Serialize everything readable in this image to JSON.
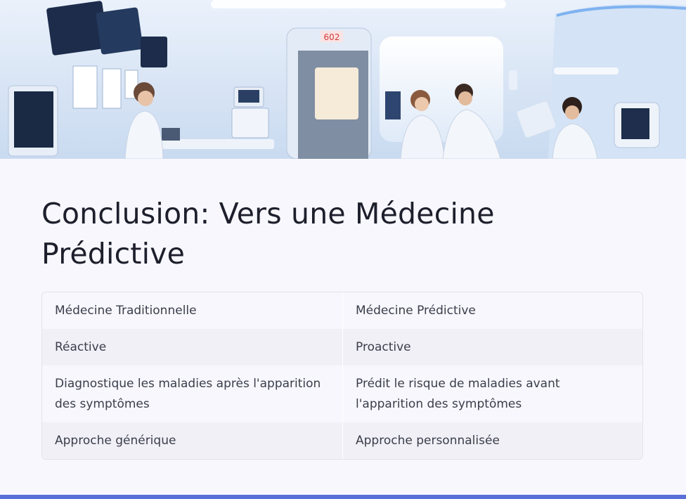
{
  "hero": {
    "door_sign": "602",
    "colors": {
      "wall": "#dce8f7",
      "panel": "#c3d6ef",
      "accent_light": "#8fb8ee",
      "door": "#7f8ea3",
      "screen": "#1c2c4a",
      "coat": "#f3f6fb"
    }
  },
  "title": "Conclusion: Vers une Médecine Prédictive",
  "table": {
    "rows": [
      [
        "Médecine Traditionnelle",
        "Médecine Prédictive"
      ],
      [
        "Réactive",
        "Proactive"
      ],
      [
        "Diagnostique les maladies après l'apparition des symptômes",
        "Prédit le risque de maladies avant l'apparition des symptômes"
      ],
      [
        "Approche générique",
        "Approche personnalisée"
      ]
    ]
  },
  "theme": {
    "background": "#f7f7fd",
    "alt_row": "#f0f0f6",
    "text": "#3b3d4a",
    "title": "#1e1f2c",
    "bottom_bar": "#5a6fd8"
  }
}
